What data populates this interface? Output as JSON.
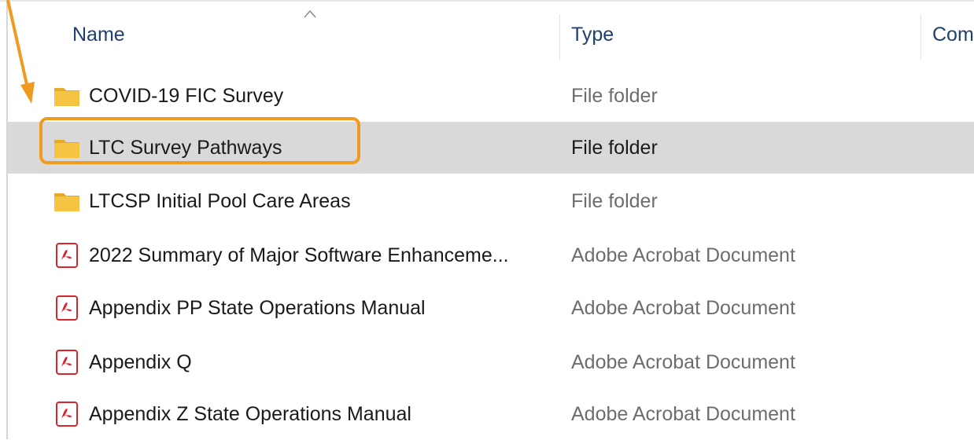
{
  "header": {
    "name_label": "Name",
    "type_label": "Type",
    "comment_label": "Com"
  },
  "rows": [
    {
      "name": "COVID-19 FIC Survey",
      "type": "File folder",
      "icon": "folder-icon"
    },
    {
      "name": "LTC Survey Pathways",
      "type": "File folder",
      "icon": "folder-icon"
    },
    {
      "name": "LTCSP Initial Pool Care Areas",
      "type": "File folder",
      "icon": "folder-icon"
    },
    {
      "name": "2022 Summary of Major Software Enhanceme...",
      "type": "Adobe Acrobat Document",
      "icon": "pdf-icon"
    },
    {
      "name": "Appendix PP State Operations Manual",
      "type": "Adobe Acrobat Document",
      "icon": "pdf-icon"
    },
    {
      "name": "Appendix Q",
      "type": "Adobe Acrobat Document",
      "icon": "pdf-icon"
    },
    {
      "name": "Appendix Z State Operations Manual",
      "type": "Adobe Acrobat Document",
      "icon": "pdf-icon"
    }
  ],
  "colors": {
    "highlight": "#f09a1f",
    "selected_row": "#d9d9d9",
    "folder": "#f5c443",
    "pdf": "#d7262e"
  }
}
